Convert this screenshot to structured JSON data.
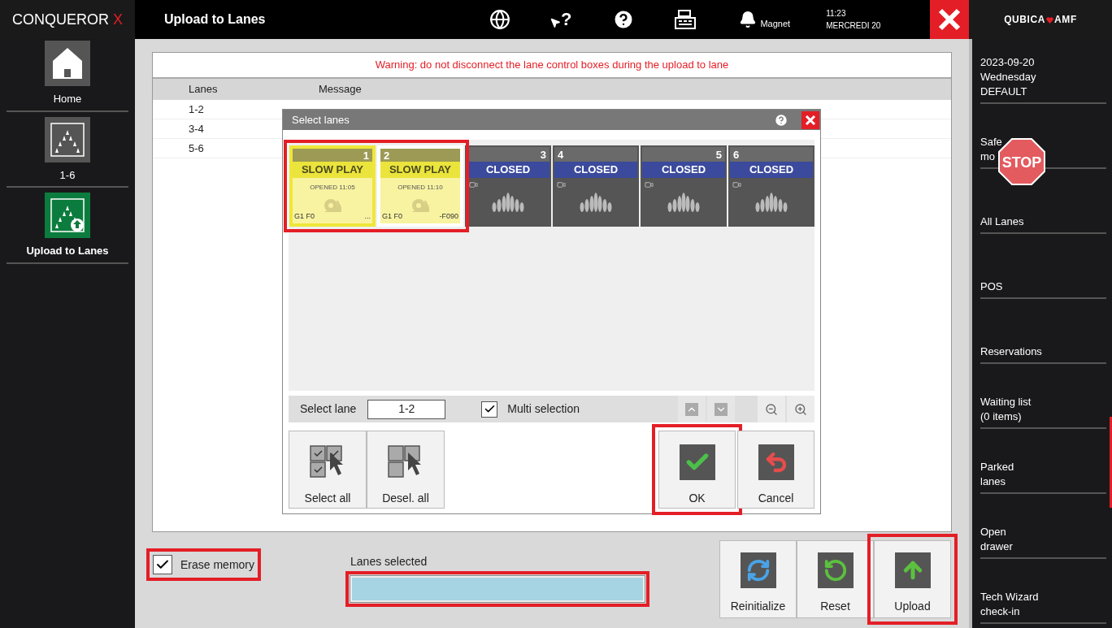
{
  "header": {
    "brand": "CONQUEROR",
    "brand_mark": "X",
    "title": "Upload to Lanes",
    "help_glyph": "?",
    "user": "Magnet",
    "time": "11:23",
    "date": "MERCREDI 20",
    "vendor": "QUBICA",
    "vendor_tail": "AMF"
  },
  "left_nav": [
    {
      "label": "Home",
      "kind": "home",
      "selected": false
    },
    {
      "label": "1-6",
      "kind": "lanes",
      "selected": false
    },
    {
      "label": "Upload to Lanes",
      "kind": "upload",
      "selected": true
    }
  ],
  "warning": "Warning: do not disconnect the lane control boxes during the upload to lane",
  "table": {
    "columns": [
      "Lanes",
      "Message"
    ],
    "rows": [
      {
        "lanes": "1-2"
      },
      {
        "lanes": "3-4"
      },
      {
        "lanes": "5-6"
      }
    ]
  },
  "dialog": {
    "title": "Select lanes",
    "lane_groups": [
      {
        "highlighted": true,
        "lanes": [
          {
            "number": "1",
            "status": "SLOW PLAY",
            "kind": "open",
            "selected": true,
            "opened": "OPENED 11:05",
            "game": "G1 F0",
            "extra": "..."
          },
          {
            "number": "2",
            "status": "SLOW PLAY",
            "kind": "open",
            "selected": false,
            "opened": "OPENED 11:10",
            "game": "G1 F0",
            "extra": "-F090"
          }
        ]
      },
      {
        "highlighted": false,
        "lanes": [
          {
            "number": "3",
            "status": "CLOSED",
            "kind": "closed",
            "selected": false
          },
          {
            "number": "4",
            "status": "CLOSED",
            "kind": "closed",
            "selected": false
          },
          {
            "number": "5",
            "status": "CLOSED",
            "kind": "closed",
            "selected": false
          },
          {
            "number": "6",
            "status": "CLOSED",
            "kind": "closed",
            "selected": false
          }
        ]
      }
    ],
    "select_lane_label": "Select lane",
    "select_lane_value": "1-2",
    "multi_selection": {
      "label": "Multi selection",
      "checked": true
    },
    "left_buttons": [
      {
        "label": "Select all",
        "kind": "select"
      },
      {
        "label": "Desel. all",
        "kind": "deselect"
      }
    ],
    "right_buttons": [
      {
        "label": "OK",
        "kind": "ok",
        "highlighted": true
      },
      {
        "label": "Cancel",
        "kind": "cancel",
        "highlighted": false
      }
    ]
  },
  "erase_memory": {
    "label": "Erase memory",
    "checked": true,
    "highlighted": true
  },
  "lanes_selected": {
    "label": "Lanes selected",
    "highlighted": true
  },
  "actions": [
    {
      "label": "Reinitialize",
      "kind": "reinit",
      "highlighted": false
    },
    {
      "label": "Reset",
      "kind": "reset",
      "highlighted": false
    },
    {
      "label": "Upload",
      "kind": "upload",
      "highlighted": true
    }
  ],
  "right_nav": [
    {
      "lines": [
        "2023-09-20",
        "Wednesday",
        "DEFAULT"
      ],
      "kind": "text"
    },
    {
      "lines": [
        "Safe",
        "mo"
      ],
      "kind": "stop",
      "stop": "STOP"
    },
    {
      "lines": [
        "All Lanes"
      ],
      "kind": "text"
    },
    {
      "lines": [
        "POS"
      ],
      "kind": "text"
    },
    {
      "lines": [
        "Reservations"
      ],
      "kind": "text"
    },
    {
      "lines": [
        "Waiting list",
        "(0 items)"
      ],
      "kind": "text"
    },
    {
      "lines": [
        "Parked",
        "lanes"
      ],
      "kind": "text"
    },
    {
      "lines": [
        "Open",
        "drawer"
      ],
      "kind": "text"
    },
    {
      "lines": [
        "Tech Wizard",
        "check-in"
      ],
      "kind": "text"
    }
  ]
}
